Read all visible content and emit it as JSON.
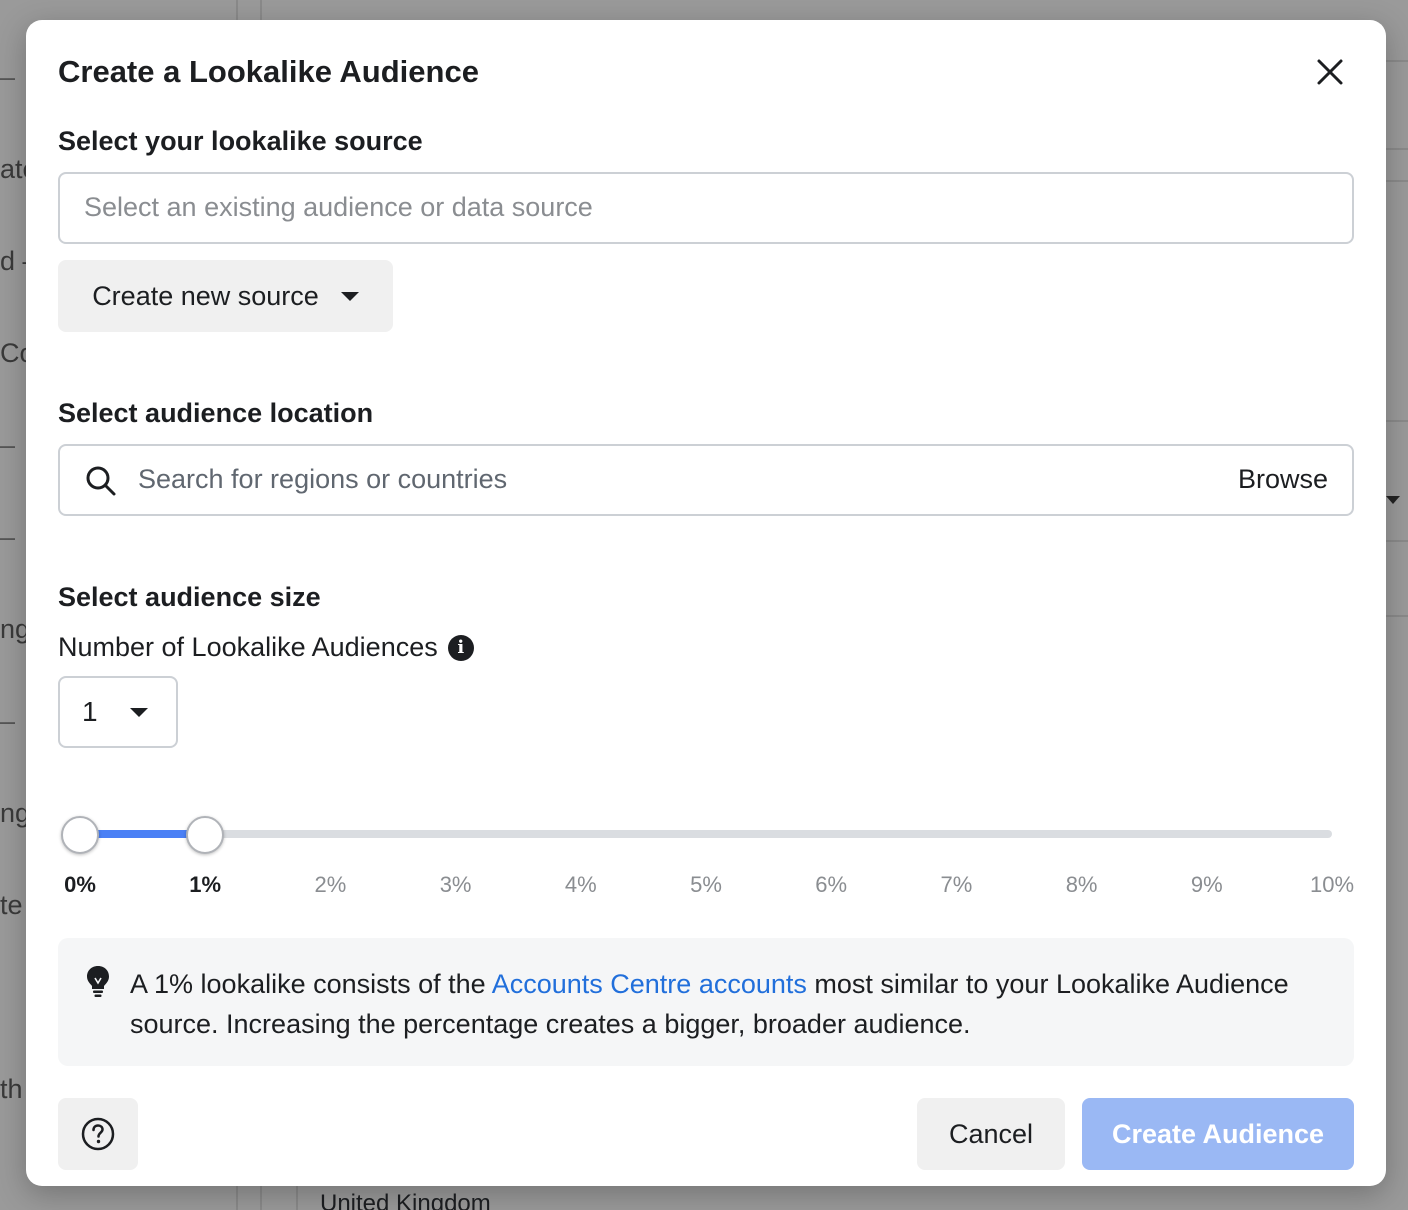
{
  "background": {
    "left_fragments": [
      "–",
      "ate",
      "d –",
      "Co",
      "–",
      "–",
      "ng",
      "–",
      "ng",
      "te",
      "th"
    ],
    "bottom_text": "United Kingdom"
  },
  "modal": {
    "title": "Create a Lookalike Audience",
    "source": {
      "label": "Select your lookalike source",
      "placeholder": "Select an existing audience or data source",
      "create_new_label": "Create new source"
    },
    "location": {
      "label": "Select audience location",
      "placeholder": "Search for regions or countries",
      "browse_label": "Browse"
    },
    "size": {
      "label": "Select audience size",
      "count_label": "Number of Lookalike Audiences",
      "count_value": "1",
      "slider": {
        "min_percent": 0,
        "max_percent": 10,
        "range_start": 0,
        "range_end": 1,
        "ticks": [
          "0%",
          "1%",
          "2%",
          "3%",
          "4%",
          "5%",
          "6%",
          "7%",
          "8%",
          "9%",
          "10%"
        ]
      }
    },
    "tip": {
      "text_before": "A 1% lookalike consists of the ",
      "link_text": "Accounts Centre accounts",
      "text_after": " most similar to your Lookalike Audience source. Increasing the percentage creates a bigger, broader audience."
    },
    "footer": {
      "cancel_label": "Cancel",
      "create_label": "Create Audience"
    }
  },
  "colors": {
    "accent": "#216fdb",
    "slider_fill": "#4a80f5",
    "create_disabled": "#9ab8f4"
  }
}
